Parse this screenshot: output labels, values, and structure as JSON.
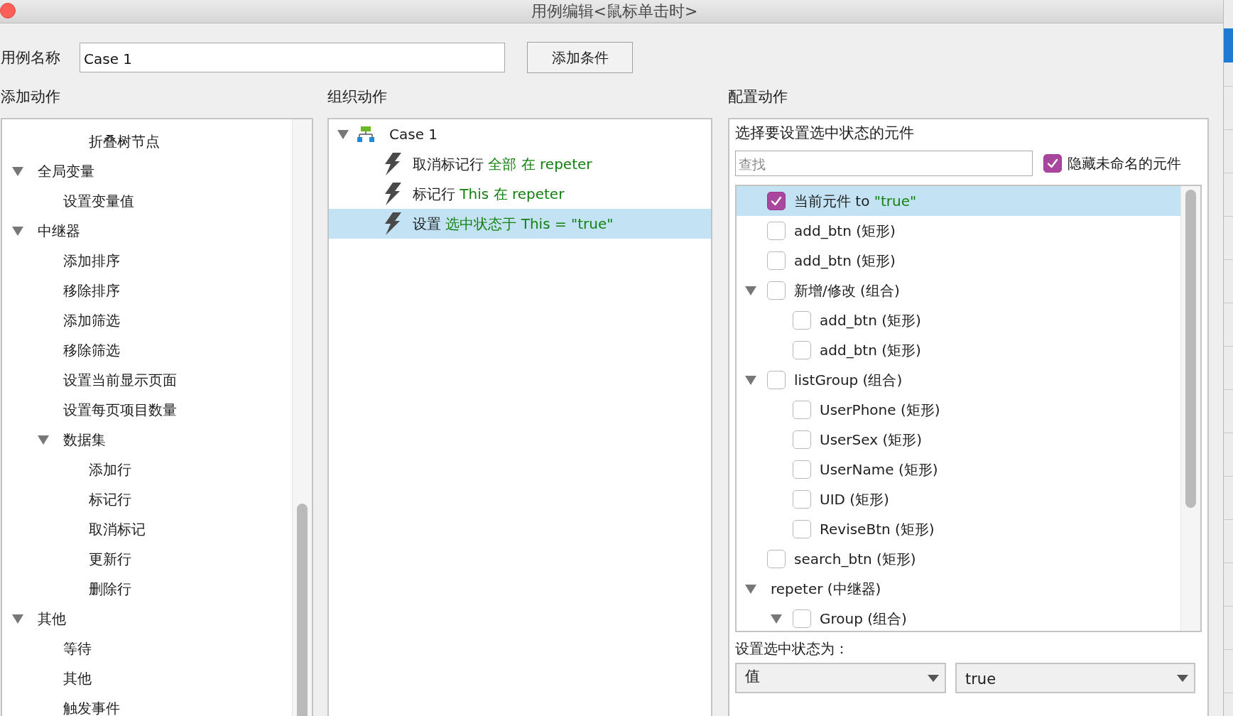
{
  "window": {
    "title": "用例编辑<鼠标单击时>"
  },
  "case_name": {
    "label": "用例名称",
    "value": "Case 1"
  },
  "add_condition_button": "添加条件",
  "add_actions": {
    "heading": "添加动作",
    "tree": [
      {
        "children": [
          {
            "children": [
              {
                "label": "折叠树节点"
              }
            ]
          }
        ]
      },
      {
        "label": "全局变量",
        "expanded": true,
        "children": [
          {
            "label": "设置变量值"
          }
        ]
      },
      {
        "label": "中继器",
        "expanded": true,
        "children": [
          {
            "label": "添加排序"
          },
          {
            "label": "移除排序"
          },
          {
            "label": "添加筛选"
          },
          {
            "label": "移除筛选"
          },
          {
            "label": "设置当前显示页面"
          },
          {
            "label": "设置每页项目数量"
          },
          {
            "label": "数据集",
            "expanded": true,
            "children": [
              {
                "label": "添加行"
              },
              {
                "label": "标记行"
              },
              {
                "label": "取消标记"
              },
              {
                "label": "更新行"
              },
              {
                "label": "删除行"
              }
            ]
          }
        ]
      },
      {
        "label": "其他",
        "expanded": true,
        "children": [
          {
            "label": "等待"
          },
          {
            "label": "其他"
          },
          {
            "label": "触发事件"
          }
        ]
      }
    ]
  },
  "organize_actions": {
    "heading": "组织动作",
    "tree": [
      {
        "kind": "case",
        "label": "Case 1",
        "expanded": true,
        "selected": false,
        "children": [
          {
            "kind": "action",
            "verb": "取消标记行",
            "target": "全部 在 repeter",
            "selected": false
          },
          {
            "kind": "action",
            "verb": "标记行",
            "target": "This 在 repeter",
            "selected": false
          },
          {
            "kind": "action",
            "verb": "设置",
            "target": "选中状态于 This = \"true\"",
            "selected": true
          }
        ]
      }
    ]
  },
  "configure_actions": {
    "heading": "配置动作",
    "title": "选择要设置选中状态的元件",
    "search": {
      "placeholder": "查找"
    },
    "hide_unnamed": {
      "label": "隐藏未命名的元件",
      "checked": true
    },
    "widgets": [
      {
        "kind": "checkbox",
        "label": "当前元件 to ",
        "value": "\"true\"",
        "checked": true,
        "selected": true
      },
      {
        "kind": "checkbox",
        "label": "add_btn (矩形)",
        "checked": false,
        "selected": false
      },
      {
        "kind": "checkbox",
        "label": "add_btn (矩形)",
        "checked": false,
        "selected": false
      },
      {
        "kind": "checkbox",
        "label": "新增/修改 (组合)",
        "checked": false,
        "selected": false,
        "expanded": true,
        "children": [
          {
            "kind": "checkbox",
            "label": "add_btn (矩形)",
            "checked": false,
            "selected": false
          },
          {
            "kind": "checkbox",
            "label": "add_btn (矩形)",
            "checked": false,
            "selected": false
          }
        ]
      },
      {
        "kind": "checkbox",
        "label": "listGroup (组合)",
        "checked": false,
        "selected": false,
        "expanded": true,
        "children": [
          {
            "kind": "checkbox",
            "label": "UserPhone (矩形)",
            "checked": false,
            "selected": false
          },
          {
            "kind": "checkbox",
            "label": "UserSex (矩形)",
            "checked": false,
            "selected": false
          },
          {
            "kind": "checkbox",
            "label": "UserName (矩形)",
            "checked": false,
            "selected": false
          },
          {
            "kind": "checkbox",
            "label": "UID (矩形)",
            "checked": false,
            "selected": false
          },
          {
            "kind": "checkbox",
            "label": "ReviseBtn (矩形)",
            "checked": false,
            "selected": false
          }
        ]
      },
      {
        "kind": "checkbox",
        "label": "search_btn (矩形)",
        "checked": false,
        "selected": false
      },
      {
        "kind": "plain",
        "label": "repeter (中继器)",
        "selected": false,
        "expanded": true,
        "children": [
          {
            "kind": "checkbox",
            "label": "Group (组合)",
            "checked": false,
            "selected": false,
            "expanded": true
          }
        ]
      }
    ],
    "state_label": "设置选中状态为：",
    "state_source": "值",
    "state_value": "true"
  }
}
